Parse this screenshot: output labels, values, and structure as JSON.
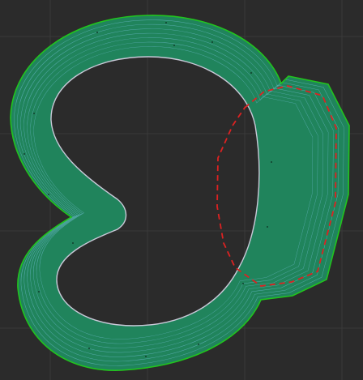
{
  "viewport": {
    "background_color": "#2b2b2b",
    "grid": true,
    "grid_color": "#3a3a3a"
  },
  "toolpath": {
    "outer_boundary_color": "#22c41e",
    "pass_color": "#5fb0b8",
    "inner_boundary_color": "#c9c9d8",
    "fill_color": "#20845c",
    "pass_count": 7
  },
  "overlay": {
    "region_color": "#dd2222",
    "region_style": "dashed"
  },
  "icons": {
    "grid": "grid-lines",
    "toolpath": "offset-toolpath-rings",
    "region": "dashed-selection-polygon"
  }
}
